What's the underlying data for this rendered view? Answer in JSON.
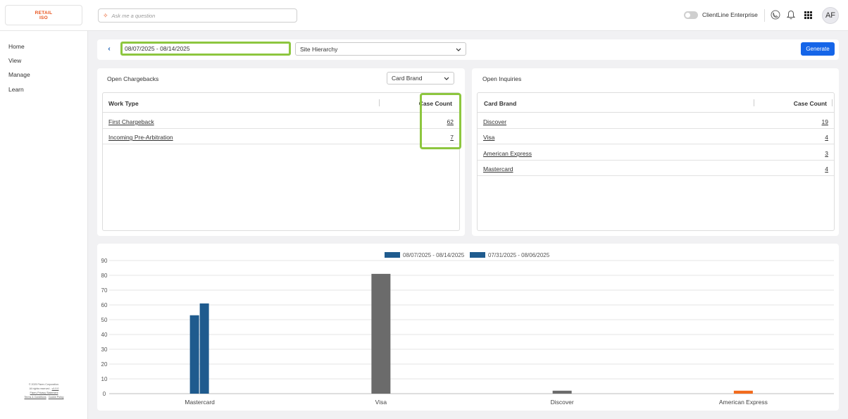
{
  "app": {
    "logo_line1": "RETAIL",
    "logo_line2": "ISO",
    "ask_placeholder": "Ask me a question",
    "toggle_label": "ClientLine Enterprise",
    "avatar_initials": "AF"
  },
  "sidebar": {
    "items": [
      {
        "label": "Home"
      },
      {
        "label": "View"
      },
      {
        "label": "Manage"
      },
      {
        "label": "Learn"
      }
    ],
    "footer": {
      "copyright": "© 2025 Fiserv Corporation.",
      "rights": "All rights reserved",
      "version": "v1.0.0",
      "privacy": "Fiserv Privacy Statement",
      "terms": "Terms & Conditions",
      "cookie": "Cookie Policy"
    }
  },
  "filters": {
    "date_range": "08/07/2025 - 08/14/2025",
    "hierarchy": "Site Hierarchy",
    "generate_label": "Generate"
  },
  "chargebacks": {
    "title": "Open Chargebacks",
    "dropdown": "Card Brand",
    "col_type": "Work Type",
    "col_count": "Case Count",
    "rows": [
      {
        "name": "First Chargeback",
        "count": "62"
      },
      {
        "name": "Incoming Pre-Arbitration",
        "count": "7"
      }
    ]
  },
  "inquiries": {
    "title": "Open Inquiries",
    "col_brand": "Card Brand",
    "col_count": "Case Count",
    "rows": [
      {
        "name": "Discover",
        "count": "19"
      },
      {
        "name": "Visa",
        "count": "4"
      },
      {
        "name": "American Express",
        "count": "3"
      },
      {
        "name": "Mastercard",
        "count": "4"
      }
    ]
  },
  "colors": {
    "accent_orange": "#e8531c",
    "highlight_green": "#8dc63f",
    "primary_blue": "#1565e8",
    "bar_blue": "#1f5b8e",
    "bar_gray": "#6b6b6b",
    "bar_orange": "#f26b1d"
  },
  "chart_data": {
    "type": "bar",
    "categories": [
      "Mastercard",
      "Visa",
      "Discover",
      "American Express"
    ],
    "series": [
      {
        "name": "08/07/2025 - 08/14/2025",
        "values": [
          53,
          0,
          0,
          0
        ]
      },
      {
        "name": "07/31/2025 - 08/06/2025",
        "values": [
          61,
          0,
          0,
          0
        ]
      }
    ],
    "extra_bars": [
      {
        "category": "Visa",
        "value": 81,
        "color": "#6b6b6b"
      },
      {
        "category": "Discover",
        "value": 2,
        "color": "#6b6b6b"
      },
      {
        "category": "American Express",
        "value": 2,
        "color": "#f26b1d"
      }
    ],
    "yticks": [
      0,
      10,
      20,
      30,
      40,
      50,
      60,
      70,
      80,
      90
    ],
    "ylim": [
      0,
      90
    ],
    "legend_position": "top-center",
    "grid": true
  }
}
